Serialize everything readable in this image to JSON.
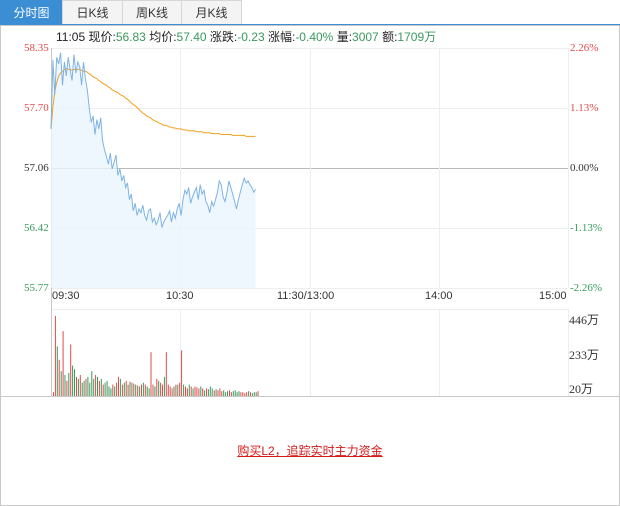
{
  "tabs": [
    {
      "label": "分时图",
      "active": true
    },
    {
      "label": "日K线",
      "active": false
    },
    {
      "label": "周K线",
      "active": false
    },
    {
      "label": "月K线",
      "active": false
    }
  ],
  "info": {
    "time": "11:05",
    "price_label": "现价:",
    "price": "56.83",
    "avg_label": "均价:",
    "avg": "57.40",
    "change_label": "涨跌:",
    "change": "-0.23",
    "pct_label": "涨幅:",
    "pct": "-0.40%",
    "vol_label": "量:",
    "vol": "3007",
    "amt_label": "额:",
    "amt": "1709万"
  },
  "colors": {
    "up": "#e24b4b",
    "down": "#3a9a5c",
    "price_line": "#7fb3e3",
    "avg_line": "#f0a020",
    "accent": "#3c8ed4"
  },
  "promo": {
    "text": "购买L2，追踪实时主力资金"
  },
  "chart_data": {
    "type": "line",
    "title": "",
    "x_ticks": [
      "09:30",
      "10:30",
      "11:30/13:00",
      "14:00",
      "15:00"
    ],
    "y_ticks_price": [
      "58.35",
      "57.70",
      "57.06",
      "56.42",
      "55.77"
    ],
    "y_ticks_pct": [
      "2.26%",
      "1.13%",
      "0.00%",
      "-1.13%",
      "-2.26%"
    ],
    "ylim": [
      55.77,
      58.35
    ],
    "prev_close": 57.06,
    "volume_ticks": [
      "446万",
      "233万",
      "20万"
    ],
    "volume_max": 446,
    "series": [
      {
        "name": "现价",
        "values": [
          57.48,
          58.22,
          57.85,
          58.25,
          58.18,
          58.3,
          57.95,
          58.2,
          58.05,
          58.25,
          58.12,
          58.0,
          58.28,
          58.08,
          58.2,
          58.15,
          57.95,
          58.2,
          58.02,
          57.9,
          57.7,
          57.55,
          57.62,
          57.42,
          57.58,
          57.48,
          57.6,
          57.35,
          57.25,
          57.18,
          57.1,
          57.22,
          57.05,
          57.12,
          57.2,
          56.98,
          57.05,
          56.92,
          56.98,
          56.85,
          56.9,
          56.72,
          56.78,
          56.6,
          56.68,
          56.55,
          56.62,
          56.58,
          56.66,
          56.55,
          56.5,
          56.6,
          56.62,
          56.48,
          56.52,
          56.45,
          56.5,
          56.58,
          56.42,
          56.48,
          56.52,
          56.55,
          56.6,
          56.48,
          56.58,
          56.52,
          56.62,
          56.68,
          56.55,
          56.72,
          56.82,
          56.78,
          56.85,
          56.68,
          56.75,
          56.8,
          56.85,
          56.72,
          56.88,
          56.78,
          56.82,
          56.7,
          56.66,
          56.58,
          56.7,
          56.65,
          56.72,
          56.8,
          56.92,
          56.88,
          56.75,
          56.7,
          56.8,
          56.92,
          56.85,
          56.78,
          56.7,
          56.62,
          56.72,
          56.8,
          56.88,
          56.95,
          56.9,
          56.92,
          56.88,
          56.85,
          56.8,
          56.83
        ]
      },
      {
        "name": "均价",
        "values": [
          57.48,
          57.72,
          57.88,
          57.98,
          58.05,
          58.08,
          58.1,
          58.12,
          58.13,
          58.12,
          58.12,
          58.11,
          58.12,
          58.12,
          58.12,
          58.12,
          58.11,
          58.1,
          58.1,
          58.09,
          58.07,
          58.06,
          58.04,
          58.03,
          58.02,
          58.0,
          57.99,
          57.97,
          57.96,
          57.95,
          57.93,
          57.92,
          57.9,
          57.89,
          57.88,
          57.87,
          57.85,
          57.84,
          57.83,
          57.81,
          57.8,
          57.78,
          57.76,
          57.74,
          57.73,
          57.71,
          57.69,
          57.67,
          57.65,
          57.64,
          57.62,
          57.61,
          57.6,
          57.58,
          57.57,
          57.56,
          57.55,
          57.54,
          57.53,
          57.52,
          57.52,
          57.51,
          57.5,
          57.5,
          57.49,
          57.49,
          57.48,
          57.48,
          57.48,
          57.47,
          57.47,
          57.47,
          57.46,
          57.46,
          57.46,
          57.46,
          57.45,
          57.45,
          57.45,
          57.45,
          57.44,
          57.44,
          57.44,
          57.44,
          57.43,
          57.43,
          57.43,
          57.43,
          57.43,
          57.42,
          57.42,
          57.42,
          57.42,
          57.42,
          57.42,
          57.41,
          57.41,
          57.41,
          57.41,
          57.41,
          57.41,
          57.41,
          57.4,
          57.4,
          57.4,
          57.4,
          57.4,
          57.4
        ]
      }
    ],
    "volume": [
      20,
      420,
      260,
      190,
      130,
      340,
      110,
      80,
      120,
      270,
      160,
      140,
      100,
      90,
      110,
      70,
      80,
      90,
      100,
      70,
      130,
      90,
      110,
      100,
      80,
      90,
      60,
      70,
      80,
      50,
      40,
      60,
      50,
      70,
      100,
      90,
      60,
      70,
      80,
      60,
      75,
      70,
      65,
      60,
      55,
      50,
      60,
      70,
      60,
      50,
      40,
      230,
      60,
      50,
      90,
      80,
      70,
      60,
      100,
      230,
      60,
      50,
      40,
      50,
      60,
      60,
      70,
      240,
      60,
      50,
      40,
      60,
      50,
      40,
      50,
      45,
      40,
      50,
      40,
      30,
      40,
      35,
      50,
      40,
      30,
      35,
      30,
      40,
      25,
      30,
      20,
      25,
      30,
      20,
      25,
      30,
      20,
      25,
      20,
      20,
      15,
      20,
      25,
      20,
      15,
      20,
      20,
      25
    ]
  }
}
